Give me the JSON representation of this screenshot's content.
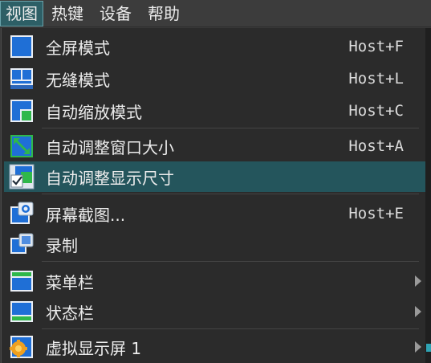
{
  "menubar": {
    "items": [
      {
        "label": "视图"
      },
      {
        "label": "热键"
      },
      {
        "label": "设备"
      },
      {
        "label": "帮助"
      }
    ]
  },
  "dropdown": {
    "items": [
      {
        "label": "全屏模式",
        "shortcut": "Host+F",
        "icon": "fullscreen-icon"
      },
      {
        "label": "无缝模式",
        "shortcut": "Host+L",
        "icon": "seamless-icon"
      },
      {
        "label": "自动缩放模式",
        "shortcut": "Host+C",
        "icon": "scale-icon"
      },
      {
        "label": "自动调整窗口大小",
        "shortcut": "Host+A",
        "icon": "resize-window-icon"
      },
      {
        "label": "自动调整显示尺寸",
        "shortcut": "",
        "icon": "auto-resize-display-icon",
        "checked": true
      },
      {
        "label": "屏幕截图...",
        "shortcut": "Host+E",
        "icon": "screenshot-icon"
      },
      {
        "label": "录制",
        "shortcut": "",
        "icon": "record-icon"
      },
      {
        "label": "菜单栏",
        "shortcut": "",
        "icon": "menubar-icon",
        "submenu": true
      },
      {
        "label": "状态栏",
        "shortcut": "",
        "icon": "statusbar-icon",
        "submenu": true
      },
      {
        "label": "虚拟显示屏 1",
        "shortcut": "",
        "icon": "virtual-screen-icon",
        "submenu": true
      }
    ]
  },
  "colors": {
    "highlight": "#24555c",
    "icon_blue": "#1f6fd6",
    "icon_green": "#2fb84a"
  }
}
